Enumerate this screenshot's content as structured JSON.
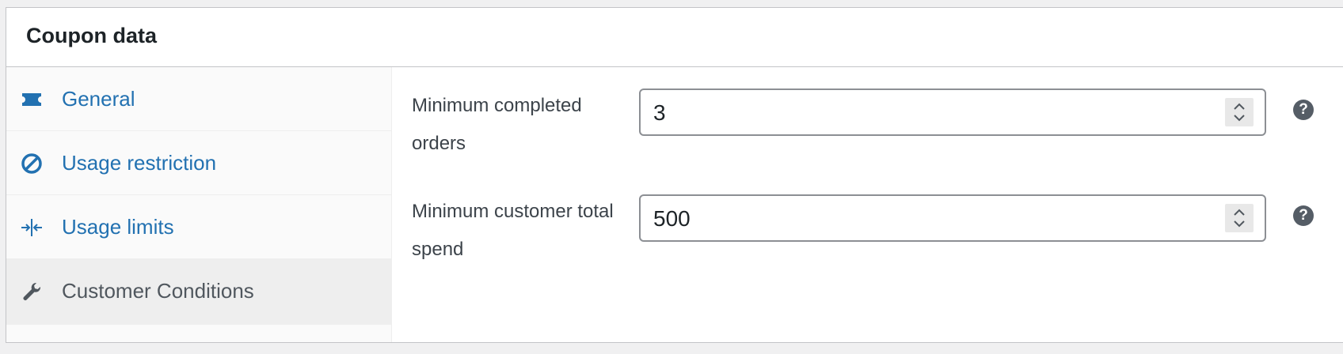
{
  "panel": {
    "title": "Coupon data"
  },
  "tabs": [
    {
      "label": "General",
      "icon": "ticket-icon",
      "active": false
    },
    {
      "label": "Usage restriction",
      "icon": "prohibited-icon",
      "active": false
    },
    {
      "label": "Usage limits",
      "icon": "limits-icon",
      "active": false
    },
    {
      "label": "Customer Conditions",
      "icon": "wrench-icon",
      "active": true
    }
  ],
  "fields": [
    {
      "label_line1": "Minimum completed",
      "label_line2": "orders",
      "value": "3",
      "help": "?"
    },
    {
      "label_line1": "Minimum customer total",
      "label_line2": "spend",
      "value": "500",
      "help": "?"
    }
  ],
  "colors": {
    "link": "#2271b1",
    "active_tab_bg": "#eeeeee",
    "help_bg": "#555d66"
  }
}
